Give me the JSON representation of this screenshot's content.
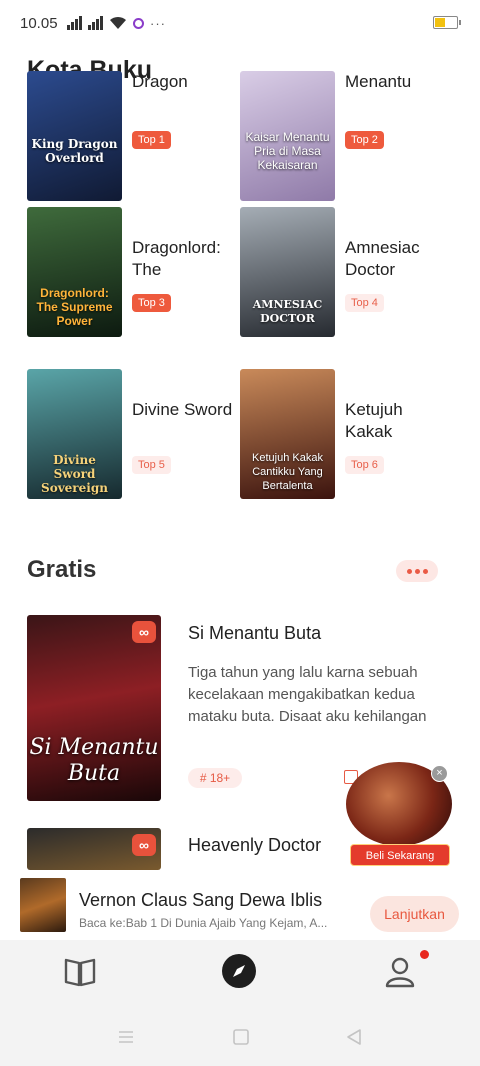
{
  "status_bar": {
    "time": "10.05",
    "more": "···",
    "icons": [
      "signal-icon",
      "signal-icon",
      "wifi-icon",
      "app-notification-icon",
      "battery-icon"
    ]
  },
  "app": {
    "title": "Kota Buku"
  },
  "ranking": {
    "books": [
      {
        "title": "Dragon",
        "cover_text": "King Dragon Overlord",
        "rank": "Top 1",
        "cover_color": "#1b2a52"
      },
      {
        "title": "Menantu",
        "cover_text": "Kaisar Menantu Pria di Masa Kekaisaran",
        "rank": "Top 2",
        "cover_color": "#c7b7d6"
      },
      {
        "title": "Dragonlord: The",
        "cover_text": "Dragonlord: The Supreme Power",
        "rank": "Top 3",
        "cover_color": "#1f3a26"
      },
      {
        "title": "Amnesiac Doctor",
        "cover_text": "AMNESIAC DOCTOR",
        "rank": "Top 4",
        "cover_color": "#5d6670"
      },
      {
        "title": "Divine Sword",
        "cover_text": "Divine Sword Sovereign",
        "rank": "Top 5",
        "cover_color": "#2d4f57"
      },
      {
        "title": "Ketujuh Kakak",
        "cover_text": "Ketujuh Kakak Cantikku Yang Bertalenta",
        "rank": "Top 6",
        "cover_color": "#6e2e22"
      }
    ]
  },
  "free_section": {
    "title": "Gratis",
    "books": [
      {
        "title": "Si Menantu Buta",
        "cover_text": "Si Menantu Buta",
        "description": "Tiga tahun yang lalu karna sebuah kecelakaan mengakibatkan kedua mataku buta. Disaat aku kehilangan",
        "tag": "# 18+",
        "badge": "∞"
      },
      {
        "title": "Heavenly Doctor",
        "cover_text": "",
        "badge": "∞"
      }
    ]
  },
  "promo": {
    "button": "Beli Sekarang",
    "close": "×"
  },
  "now_reading": {
    "title": "Vernon Claus Sang Dewa Iblis",
    "subtitle": "Baca ke:Bab 1 Di Dunia Ajaib Yang Kejam, A...",
    "button": "Lanjutkan"
  },
  "tabbar": {
    "icons": [
      "bookshelf-icon",
      "discover-compass-icon",
      "profile-icon"
    ]
  },
  "colors": {
    "accent": "#ea5a45",
    "badge_hot": "#ee5a3d",
    "badge_cool_bg": "#fdecea"
  }
}
